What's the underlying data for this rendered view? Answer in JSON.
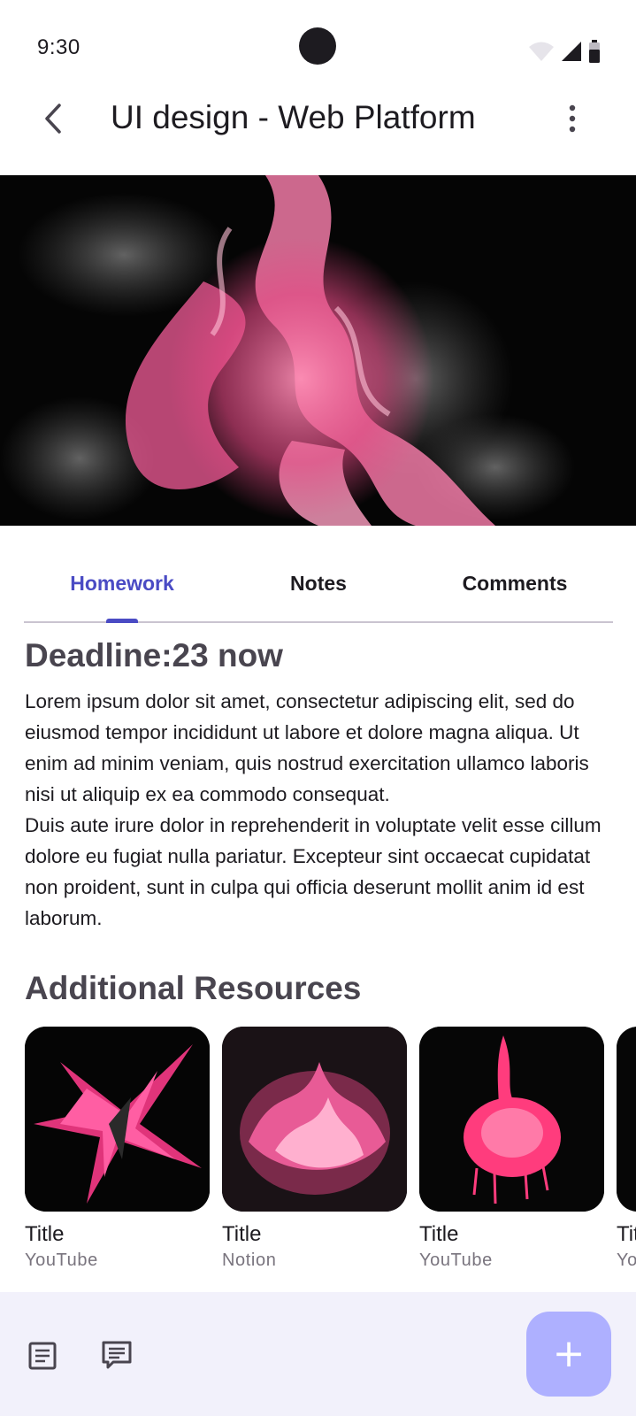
{
  "status_bar": {
    "time": "9:30"
  },
  "header": {
    "title": "UI design - Web Platform",
    "back_icon": "arrow-back-icon",
    "more_icon": "more-vert-icon"
  },
  "hero": {
    "image": "pink-smoke-hero-image"
  },
  "tabs": [
    {
      "label": "Homework",
      "active": true
    },
    {
      "label": "Notes",
      "active": false
    },
    {
      "label": "Comments",
      "active": false
    }
  ],
  "assignment": {
    "deadline": "Deadline:23 now",
    "paragraphs": [
      "Lorem ipsum dolor sit amet, consectetur adipiscing elit, sed do eiusmod tempor incididunt ut labore et dolore magna aliqua. Ut enim ad minim veniam, quis nostrud exercitation ullamco laboris nisi ut aliquip ex ea commodo consequat.",
      "Duis aute irure dolor in reprehenderit in voluptate velit esse cillum dolore eu fugiat nulla pariatur. Excepteur sint occaecat cupidatat non proident, sunt in culpa qui officia deserunt mollit anim id est laborum."
    ]
  },
  "resources": {
    "title": "Additional Resources",
    "items": [
      {
        "title": "Title",
        "source": "YouTube"
      },
      {
        "title": "Title",
        "source": "Notion"
      },
      {
        "title": "Title",
        "source": "YouTube"
      },
      {
        "title": "Title",
        "source": "YouTube"
      }
    ]
  },
  "bottom_bar": {
    "icons": [
      "article-icon",
      "comment-icon"
    ],
    "fab_icon": "add-icon",
    "fab_glyph": "+"
  },
  "colors": {
    "accent": "#4a4bc4",
    "fab": "#aeb0ff",
    "bottom_bar_bg": "#f2f1fb",
    "heading": "#49454f",
    "pink": "#ff4d8d"
  }
}
